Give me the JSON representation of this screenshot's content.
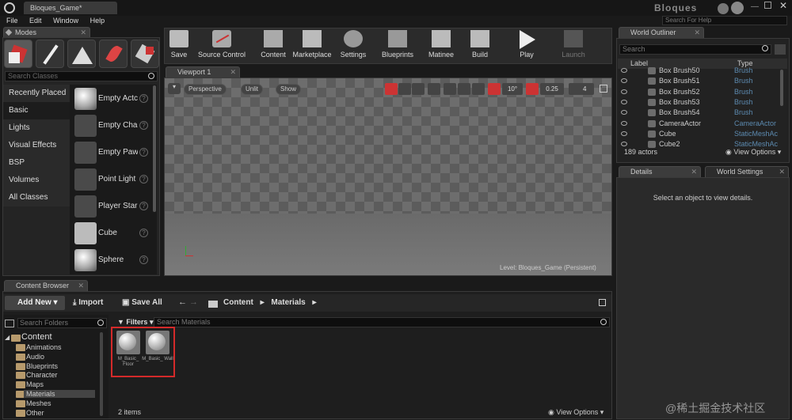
{
  "titlebar": {
    "tab": "Bloques_Game*",
    "project": "Bloques",
    "help_search": "Search For Help"
  },
  "menu": [
    "File",
    "Edit",
    "Window",
    "Help"
  ],
  "modes": {
    "title": "Modes",
    "search_placeholder": "Search Classes",
    "categories": [
      "Recently Placed",
      "Basic",
      "Lights",
      "Visual Effects",
      "BSP",
      "Volumes",
      "All Classes"
    ],
    "items": [
      "Empty Actc",
      "Empty Char",
      "Empty Paw",
      "Point Light",
      "Player Star",
      "Cube",
      "Sphere"
    ]
  },
  "toolbar": {
    "buttons": [
      "Save",
      "Source Control",
      "Content",
      "Marketplace",
      "Settings",
      "Blueprints",
      "Matinee",
      "Build",
      "Play",
      "Launch"
    ]
  },
  "viewport": {
    "tab": "Viewport 1",
    "perspective": "Perspective",
    "unlit": "Unlit",
    "show": "Show",
    "angle": "10°",
    "scale": "0.25",
    "speed": "4",
    "level": "Level: Bloques_Game (Persistent)"
  },
  "outliner": {
    "title": "World Outliner",
    "search_placeholder": "Search",
    "col_label": "Label",
    "col_type": "Type",
    "rows": [
      {
        "label": "Box Brush50",
        "type": "Brush"
      },
      {
        "label": "Box Brush51",
        "type": "Brush"
      },
      {
        "label": "Box Brush52",
        "type": "Brush"
      },
      {
        "label": "Box Brush53",
        "type": "Brush"
      },
      {
        "label": "Box Brush54",
        "type": "Brush"
      },
      {
        "label": "CameraActor",
        "type": "CameraActor"
      },
      {
        "label": "Cube",
        "type": "StaticMeshAc"
      },
      {
        "label": "Cube2",
        "type": "StaticMeshAc"
      }
    ],
    "count": "189 actors",
    "view_options": "View Options"
  },
  "details": {
    "tab1": "Details",
    "tab2": "World Settings",
    "message": "Select an object to view details."
  },
  "content_browser": {
    "tab": "Content Browser",
    "add_new": "Add New",
    "import": "Import",
    "save_all": "Save All",
    "path": [
      "Content",
      "Materials"
    ],
    "search_folders": "Search Folders",
    "filters": "Filters",
    "search_materials": "Search Materials",
    "tree_root": "Content",
    "tree": [
      "Animations",
      "Audio",
      "Blueprints",
      "Character",
      "Maps",
      "Materials",
      "Meshes",
      "Other"
    ],
    "assets": [
      "M_Basic_ Floor",
      "M_Basic_ Wall"
    ],
    "count": "2 items",
    "view_options": "View Options"
  },
  "watermark": "@稀土掘金技术社区",
  "colors": {
    "highlight_box": "#d42a2a",
    "toolbar_bg": "#2b2b2b",
    "panel_bg": "#1e1e1e",
    "type_text": "#5c8ab0"
  }
}
